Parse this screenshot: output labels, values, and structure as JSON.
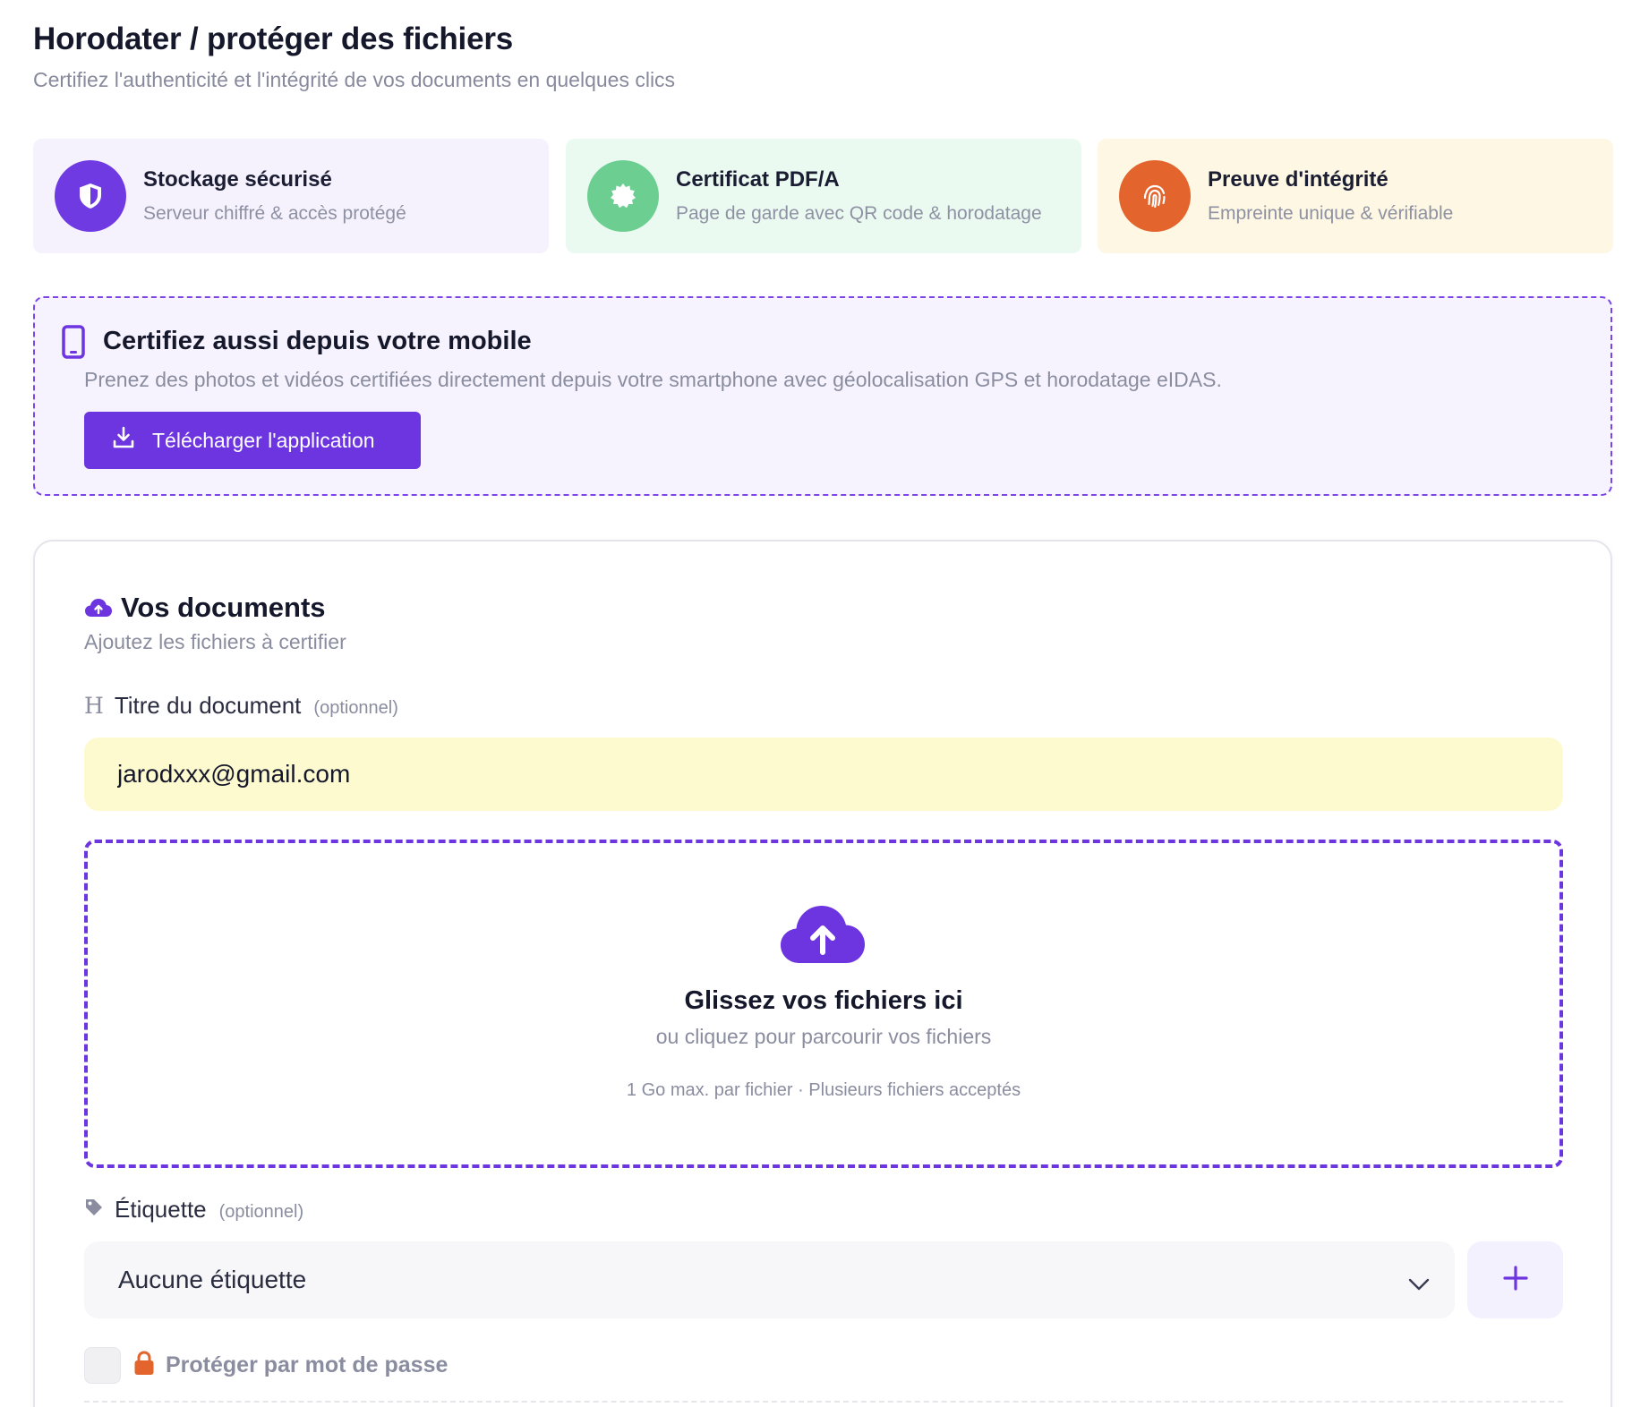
{
  "header": {
    "title": "Horodater / protéger des fichiers",
    "subtitle": "Certifiez l'authenticité et l'intégrité de vos documents en quelques clics"
  },
  "features": [
    {
      "title": "Stockage sécurisé",
      "subtitle": "Serveur chiffré & accès protégé",
      "icon": "shield-icon",
      "color": "#6f3ae2"
    },
    {
      "title": "Certificat PDF/A",
      "subtitle": "Page de garde avec QR code & horodatage",
      "icon": "certificate-icon",
      "color": "#6cce91"
    },
    {
      "title": "Preuve d'intégrité",
      "subtitle": "Empreinte unique & vérifiable",
      "icon": "fingerprint-icon",
      "color": "#e3642d"
    }
  ],
  "mobile": {
    "title": "Certifiez aussi depuis votre mobile",
    "subtitle": "Prenez des photos et vidéos certifiées directement depuis votre smartphone avec géolocalisation GPS et horodatage eIDAS.",
    "button_label": "Télécharger l'application"
  },
  "documents": {
    "title": "Vos documents",
    "subtitle": "Ajoutez les fichiers à certifier",
    "title_field": {
      "label": "Titre du document",
      "optional": "(optionnel)",
      "value": "jarodxxx@gmail.com"
    },
    "dropzone": {
      "title": "Glissez vos fichiers ici",
      "subtitle": "ou cliquez pour parcourir vos fichiers",
      "hint": "1 Go max. par fichier · Plusieurs fichiers acceptés"
    },
    "tag_field": {
      "label": "Étiquette",
      "optional": "(optionnel)",
      "selected": "Aucune étiquette"
    },
    "password": {
      "label": "Protéger par mot de passe",
      "checked": false
    }
  },
  "colors": {
    "accent": "#6d35e0",
    "input_highlight": "#fefacf"
  }
}
